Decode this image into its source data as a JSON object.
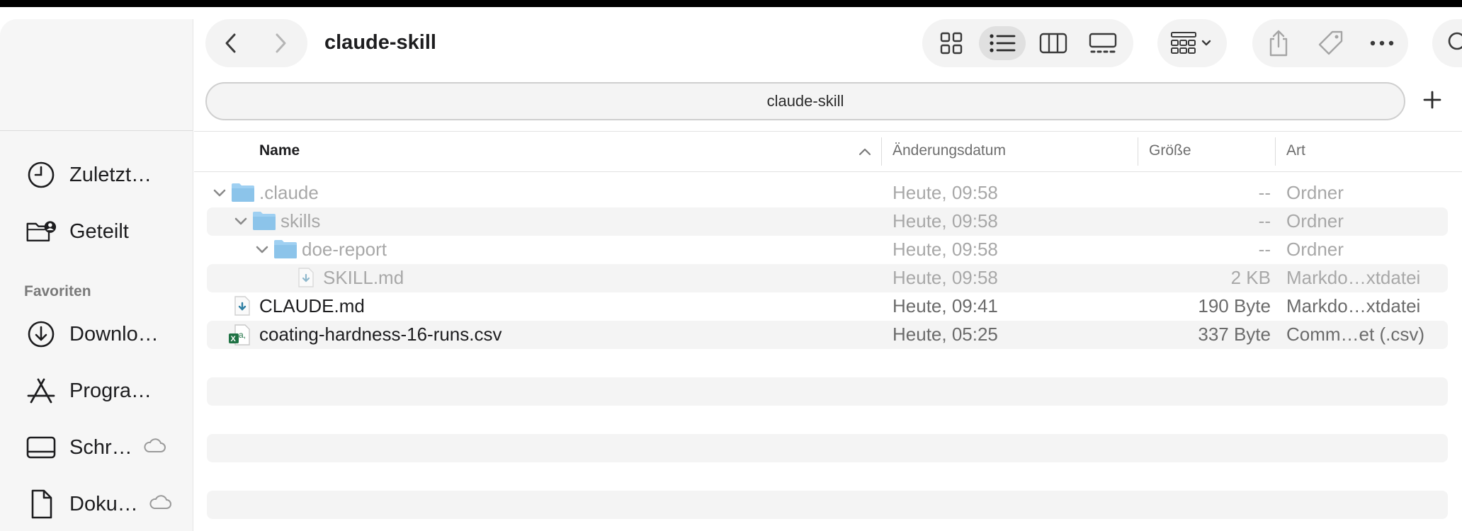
{
  "window": {
    "title": "claude-skill"
  },
  "pathbar": {
    "label": "claude-skill"
  },
  "sidebar": {
    "items_top": [
      {
        "label": "Zuletzt…",
        "icon": "clock-icon"
      },
      {
        "label": "Geteilt",
        "icon": "shared-folder-icon"
      }
    ],
    "favorites_heading": "Favoriten",
    "favorites": [
      {
        "label": "Downlo…",
        "icon": "download-icon"
      },
      {
        "label": "Progra…",
        "icon": "applications-icon"
      },
      {
        "label": "Schr…",
        "icon": "desktop-icon",
        "cloud": true
      },
      {
        "label": "Doku…",
        "icon": "document-icon",
        "cloud": true
      }
    ]
  },
  "toolbar": {
    "back_icon": "chevron-left-icon",
    "forward_icon": "chevron-right-icon",
    "view_modes": [
      "icon-view",
      "list-view",
      "column-view",
      "gallery-view"
    ],
    "active_view": "list-view"
  },
  "table": {
    "columns": {
      "name": "Name",
      "date": "Änderungsdatum",
      "size": "Größe",
      "kind": "Art"
    },
    "rows": [
      {
        "name": ".claude",
        "date": "Heute, 09:58",
        "size": "--",
        "kind": "Ordner"
      },
      {
        "name": "skills",
        "date": "Heute, 09:58",
        "size": "--",
        "kind": "Ordner"
      },
      {
        "name": "doe-report",
        "date": "Heute, 09:58",
        "size": "--",
        "kind": "Ordner"
      },
      {
        "name": "SKILL.md",
        "date": "Heute, 09:58",
        "size": "2 KB",
        "kind": "Markdo…xtdatei"
      },
      {
        "name": "CLAUDE.md",
        "date": "Heute, 09:41",
        "size": "190 Byte",
        "kind": "Markdo…xtdatei"
      },
      {
        "name": "coating-hardness-16-runs.csv",
        "date": "Heute, 05:25",
        "size": "337 Byte",
        "kind": "Comm…et (.csv)"
      }
    ]
  },
  "colors": {
    "folder": "#8ec5ec",
    "dim_text": "#a8a8a8",
    "stripe": "#f4f4f4"
  }
}
